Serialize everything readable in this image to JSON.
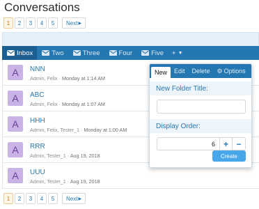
{
  "page": {
    "title": "Conversations"
  },
  "pager": {
    "pages": [
      "1",
      "2",
      "3",
      "4",
      "5"
    ],
    "current": "1",
    "next_label": "Next"
  },
  "tabs": [
    {
      "label": "Inbox",
      "icon": "envelope-icon",
      "active": true
    },
    {
      "label": "Two",
      "icon": "envelope-icon",
      "active": false
    },
    {
      "label": "Three",
      "icon": "envelope-icon",
      "active": false
    },
    {
      "label": "Four",
      "icon": "envelope-icon",
      "active": false
    },
    {
      "label": "Five",
      "icon": "envelope-icon",
      "active": false
    }
  ],
  "tab_plus": "+",
  "conversations": [
    {
      "avatar": "A",
      "title": "NNN",
      "participants": "Admin, Felix",
      "time": "Monday at 1:14 AM"
    },
    {
      "avatar": "A",
      "title": "ABC",
      "participants": "Admin, Felix",
      "time": "Monday at 1:07 AM"
    },
    {
      "avatar": "A",
      "title": "HHH",
      "participants": "Admin, Felix, Tester_1",
      "time": "Monday at 1:00 AM"
    },
    {
      "avatar": "A",
      "title": "RRR",
      "participants": "Admin, Tester_1",
      "time": "Aug 19, 2018"
    },
    {
      "avatar": "A",
      "title": "UUU",
      "participants": "Admin, Tester_1",
      "time": "Aug 19, 2018"
    }
  ],
  "popup": {
    "tabs": [
      "New",
      "Edit",
      "Delete",
      "Options"
    ],
    "folder_title_label": "New Folder Title:",
    "folder_title_value": "",
    "display_order_label": "Display Order:",
    "display_order_value": "6",
    "plus": "+",
    "minus": "−",
    "create_label": "Create"
  },
  "colors": {
    "accent": "#2577b1",
    "tab_active": "#1c5f92",
    "button": "#47a7eb",
    "avatar_bg": "#c9b2e6"
  }
}
